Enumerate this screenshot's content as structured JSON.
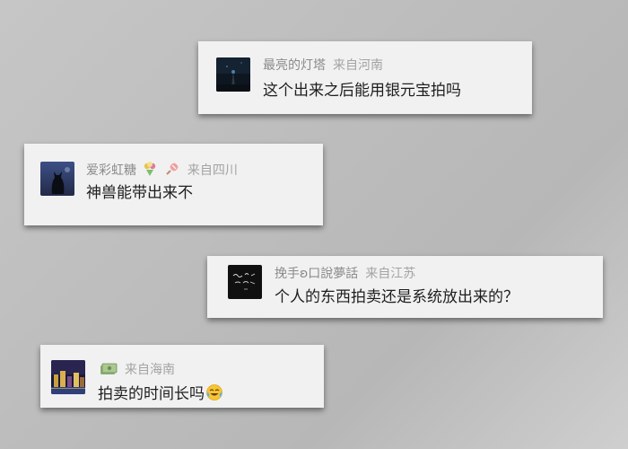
{
  "comments": [
    {
      "username": "最亮的灯塔",
      "location": "来自河南",
      "text": "这个出来之后能用银元宝拍吗",
      "avatar_icon": "night-tower-avatar-icon"
    },
    {
      "username": "爱彩虹糖",
      "location": "来自四川",
      "text": "神兽能带出来不",
      "avatar_icon": "black-cat-avatar-icon",
      "name_emojis": [
        "bouquet-emoji-icon",
        "candy-emoji-icon"
      ]
    },
    {
      "username": "挽手ʚ口說夢話",
      "location": "来自江苏",
      "text": "个人的东西拍卖还是系统放出来的？",
      "avatar_icon": "dark-handwriting-avatar-icon"
    },
    {
      "username": "",
      "location": "来自海南",
      "text": "拍卖的时间长吗",
      "avatar_icon": "city-night-avatar-icon",
      "name_emojis": [
        "money-bag-emoji-icon"
      ],
      "text_emoji": "laughing-tears-emoji-icon"
    }
  ],
  "colors": {
    "card_background": "#f1f1f2",
    "username_gray": "#8a8a8a",
    "location_gray": "#a3a3a3",
    "message_text": "#1e1e1e"
  }
}
